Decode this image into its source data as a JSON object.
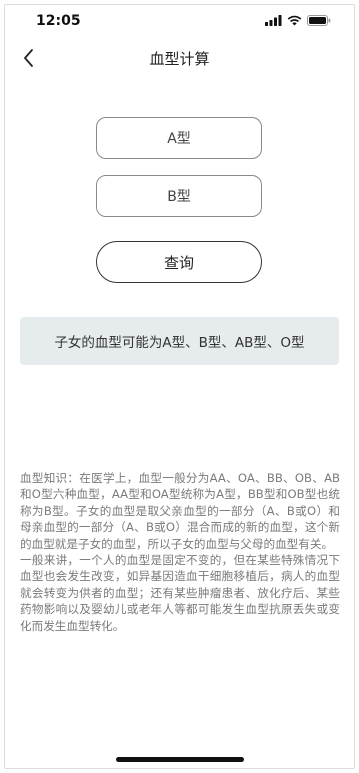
{
  "status_bar": {
    "time": "12:05"
  },
  "nav": {
    "title": "血型计算"
  },
  "form": {
    "father_blood_type": "A型",
    "mother_blood_type": "B型",
    "query_label": "查询"
  },
  "result": {
    "text": "子女的血型可能为A型、B型、AB型、O型"
  },
  "knowledge": {
    "paragraph_1": "血型知识：在医学上，血型一般分为AA、OA、BB、OB、AB和O型六种血型，AA型和OA型统称为A型，BB型和OB型也统称为B型。子女的血型是取父亲血型的一部分（A、B或O）和母亲血型的一部分（A、B或O）混合而成的新的血型，这个新的血型就是子女的血型，所以子女的血型与父母的血型有关。",
    "paragraph_2": "一般来讲，一个人的血型是固定不变的，但在某些特殊情况下血型也会发生改变，如异基因造血干细胞移植后，病人的血型就会转变为供者的血型；还有某些肿瘤患者、放化疗后、某些药物影响以及婴幼儿或老年人等都可能发生血型抗原丢失或变化而发生血型转化。"
  },
  "icons": {
    "back": "chevron-left-icon",
    "signal": "signal-icon",
    "wifi": "wifi-icon",
    "battery": "battery-icon"
  }
}
